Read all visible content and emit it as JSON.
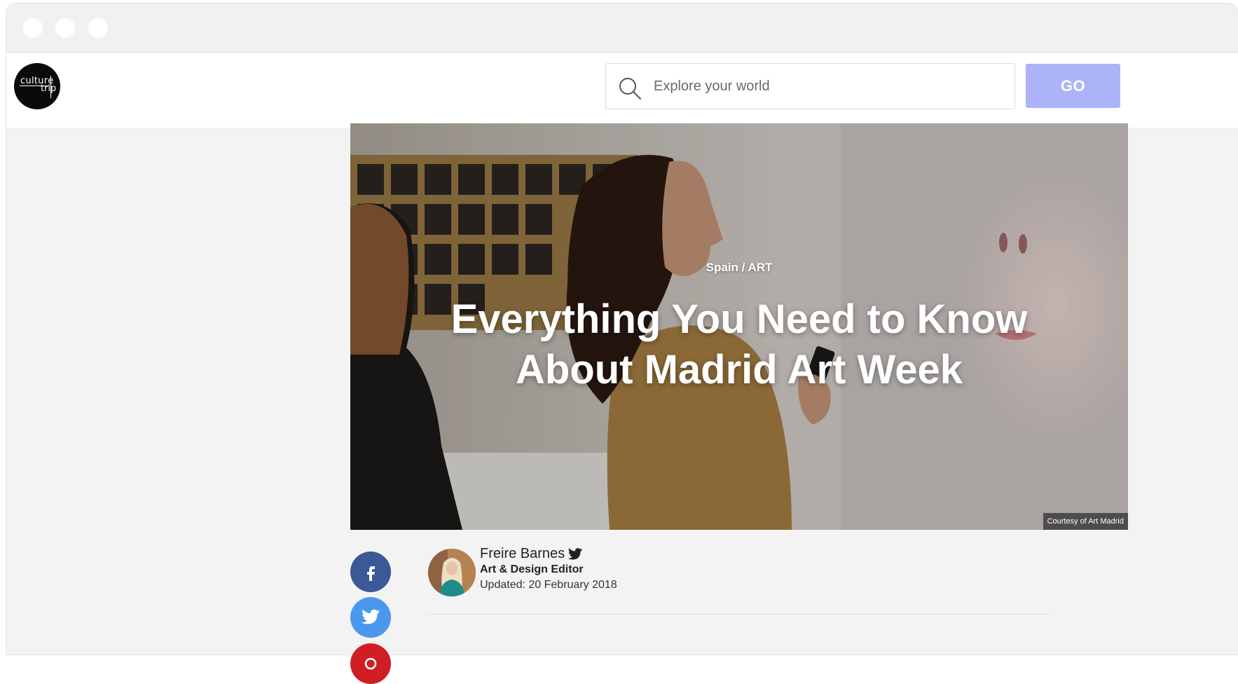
{
  "header": {
    "logo_line1": "culture",
    "logo_line2": "trip",
    "search": {
      "placeholder": "Explore your world",
      "value": ""
    },
    "go_label": "GO"
  },
  "article": {
    "breadcrumb": "Spain / ART",
    "title": "Everything You Need to Know About Madrid Art Week",
    "image_credit": "Courtesy of Art Madrid",
    "author": {
      "name": "Freire Barnes",
      "role": "Art & Design Editor",
      "updated": "Updated: 20 February 2018"
    }
  },
  "share": [
    "facebook-icon",
    "twitter-icon",
    "pinterest-icon"
  ],
  "colors": {
    "go_button": "#adb3f8",
    "facebook": "#3b5897",
    "twitter": "#4a98ee",
    "pinterest": "#cf1f24"
  }
}
